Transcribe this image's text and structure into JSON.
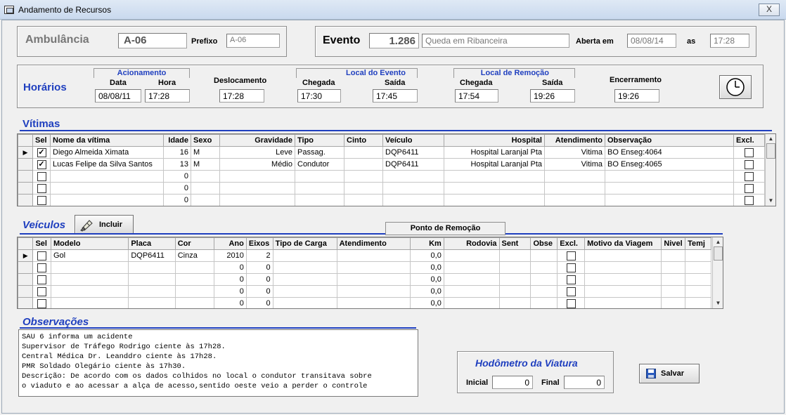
{
  "window": {
    "title": "Andamento de Recursos",
    "close_label": "X"
  },
  "ambulancia": {
    "label": "Ambulância",
    "value": "A-06",
    "prefixo_label": "Prefixo",
    "prefixo_value": "A-06"
  },
  "evento": {
    "label": "Evento",
    "number": "1.286",
    "description": "Queda em Ribanceira",
    "aberta_label": "Aberta em",
    "aberta_date": "08/08/14",
    "as_label": "as",
    "aberta_time": "17:28"
  },
  "horarios": {
    "title": "Horários",
    "acionamento": {
      "group": "Acionamento",
      "data_label": "Data",
      "hora_label": "Hora",
      "data": "08/08/11",
      "hora": "17:28"
    },
    "deslocamento": {
      "label": "Deslocamento",
      "value": "17:28"
    },
    "local_evento": {
      "group": "Local do Evento",
      "chegada_label": "Chegada",
      "saida_label": "Saída",
      "chegada": "17:30",
      "saida": "17:45"
    },
    "local_remocao": {
      "group": "Local de Remoção",
      "chegada_label": "Chegada",
      "saida_label": "Saída",
      "chegada": "17:54",
      "saida": "19:26"
    },
    "encerramento": {
      "label": "Encerramento",
      "value": "19:26"
    },
    "clock_icon": "clock-icon"
  },
  "vitimas": {
    "title": "Vítimas",
    "columns": [
      "Sel",
      "Nome da vítima",
      "Idade",
      "Sexo",
      "Gravidade",
      "Tipo",
      "Cinto",
      "Veículo",
      "Hospital",
      "Atendimento",
      "Observação",
      "Excl."
    ],
    "rows": [
      {
        "current": true,
        "sel": true,
        "nome": "Diego Almeida Ximata",
        "idade": "16",
        "sexo": "M",
        "gravidade": "Leve",
        "tipo": "Passag.",
        "cinto": "",
        "veiculo": "DQP6411",
        "hospital": "Hospital Laranjal Pta",
        "atendimento": "Vitima",
        "observacao": "BO Enseg:4064",
        "excl": false
      },
      {
        "current": false,
        "sel": true,
        "nome": "Lucas Felipe da Silva Santos",
        "idade": "13",
        "sexo": "M",
        "gravidade": "Médio",
        "tipo": "Condutor",
        "cinto": "",
        "veiculo": "DQP6411",
        "hospital": "Hospital Laranjal Pta",
        "atendimento": "Vitima",
        "observacao": "BO Enseg:4065",
        "excl": false
      },
      {
        "current": false,
        "sel": false,
        "nome": "",
        "idade": "0",
        "sexo": "",
        "gravidade": "",
        "tipo": "",
        "cinto": "",
        "veiculo": "",
        "hospital": "",
        "atendimento": "",
        "observacao": "",
        "excl": false
      },
      {
        "current": false,
        "sel": false,
        "nome": "",
        "idade": "0",
        "sexo": "",
        "gravidade": "",
        "tipo": "",
        "cinto": "",
        "veiculo": "",
        "hospital": "",
        "atendimento": "",
        "observacao": "",
        "excl": false
      },
      {
        "current": false,
        "sel": false,
        "nome": "",
        "idade": "0",
        "sexo": "",
        "gravidade": "",
        "tipo": "",
        "cinto": "",
        "veiculo": "",
        "hospital": "",
        "atendimento": "",
        "observacao": "",
        "excl": false
      }
    ]
  },
  "veiculos": {
    "title": "Veículos",
    "incluir_label": "Incluir",
    "ponto_remocao_label": "Ponto de Remoção",
    "columns": [
      "Sel",
      "Modelo",
      "Placa",
      "Cor",
      "Ano",
      "Eixos",
      "Tipo de Carga",
      "Atendimento",
      "Km",
      "Rodovia",
      "Sent",
      "Obse",
      "Excl.",
      "Motivo da Viagem",
      "Nivel",
      "Temj"
    ],
    "rows": [
      {
        "current": true,
        "sel": false,
        "modelo": "Gol",
        "placa": "DQP6411",
        "cor": "Cinza",
        "ano": "2010",
        "eixos": "2",
        "km": "0,0",
        "excl": false
      },
      {
        "current": false,
        "sel": false,
        "modelo": "",
        "placa": "",
        "cor": "",
        "ano": "0",
        "eixos": "0",
        "km": "0,0",
        "excl": false
      },
      {
        "current": false,
        "sel": false,
        "modelo": "",
        "placa": "",
        "cor": "",
        "ano": "0",
        "eixos": "0",
        "km": "0,0",
        "excl": false
      },
      {
        "current": false,
        "sel": false,
        "modelo": "",
        "placa": "",
        "cor": "",
        "ano": "0",
        "eixos": "0",
        "km": "0,0",
        "excl": false
      },
      {
        "current": false,
        "sel": false,
        "modelo": "",
        "placa": "",
        "cor": "",
        "ano": "0",
        "eixos": "0",
        "km": "0,0",
        "excl": false
      }
    ]
  },
  "observacoes": {
    "title": "Observações",
    "text": "SAU 6 informa um acidente\nSupervisor de Tráfego Rodrigo ciente às 17h28.\nCentral Médica Dr. Leanddro ciente às 17h28.\nPMR Soldado Olegário ciente às 17h30.\nDescrição: De acordo com os dados colhidos no local o condutor transitava sobre\no viaduto e ao acessar a alça de acesso,sentido oeste veio a perder o controle"
  },
  "hodometro": {
    "title": "Hodômetro da Viatura",
    "inicial_label": "Inicial",
    "inicial": "0",
    "final_label": "Final",
    "final": "0"
  },
  "salvar": {
    "label": "Salvar"
  },
  "colors": {
    "accent_blue": "#1f3fbf",
    "window_bg": "#f0f0f0"
  }
}
